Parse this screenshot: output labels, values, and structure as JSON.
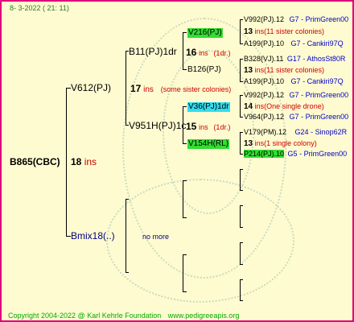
{
  "header": {
    "date": "8-  3-2022 ( 21: 11)"
  },
  "root": {
    "name": "B865(CBC)",
    "num": "18",
    "ins": "ins"
  },
  "father": {
    "name": "V612(PJ)",
    "num": "17",
    "ins": "ins",
    "note": "(some sister colonies)"
  },
  "mother": {
    "name": "Bmix18(..)",
    "note": "no more"
  },
  "ff": {
    "name": "B11(PJ)1dr",
    "num": "16",
    "ins": "ins",
    "note": "(1dr.)"
  },
  "fm": {
    "name": "V951H(PJ)1c",
    "num": "15",
    "ins": "ins",
    "note": "(1dr.)"
  },
  "fff": {
    "name": "V216(PJ)"
  },
  "ffm": {
    "name": "B126(PJ)"
  },
  "fmf": {
    "name": "V36(PJ)1dr"
  },
  "fmm": {
    "name": "V154H(RL)"
  },
  "leaves": [
    {
      "name": "V992(PJ).12",
      "code": "G7",
      "place": "- PrimGreen00"
    },
    {
      "num": "13",
      "ins": "ins",
      "note": "(11 sister colonies)"
    },
    {
      "name": "A199(PJ).10",
      "code": "G7",
      "place": "- Cankiri97Q"
    },
    {
      "name": "B328(VJ).11",
      "code": "G17",
      "place": "- AthosSt80R"
    },
    {
      "num": "13",
      "ins": "ins",
      "note": "(11 sister colonies)"
    },
    {
      "name": "A199(PJ).10",
      "code": "G7",
      "place": "- Cankiri97Q"
    },
    {
      "name": "V992(PJ).12",
      "code": "G7",
      "place": "- PrimGreen00"
    },
    {
      "num": "14",
      "ins": "ins",
      "note": "(One single drone)"
    },
    {
      "name": "V964(PJ).12",
      "code": "G7",
      "place": "- PrimGreen00"
    },
    {
      "name": "V179(PM).12",
      "code": "G24",
      "place": "- Sinop62R"
    },
    {
      "num": "13",
      "ins": "ins",
      "note": "(1 single colony)"
    },
    {
      "name": "P214(PJ).10",
      "code": "G5",
      "place": "- PrimGreen00"
    }
  ],
  "footer": {
    "copyright": "Copyright 2004-2022 @ Karl Kehrle Foundation",
    "url": "www.pedigreeapis.org"
  },
  "colors": {
    "border": "#e0007a",
    "background": "#fffbd0",
    "ins": "#cc0000",
    "place": "#0000cc",
    "highlight_green": "#33dd33",
    "highlight_cyan": "#33ddee",
    "footer": "#00aa00"
  }
}
